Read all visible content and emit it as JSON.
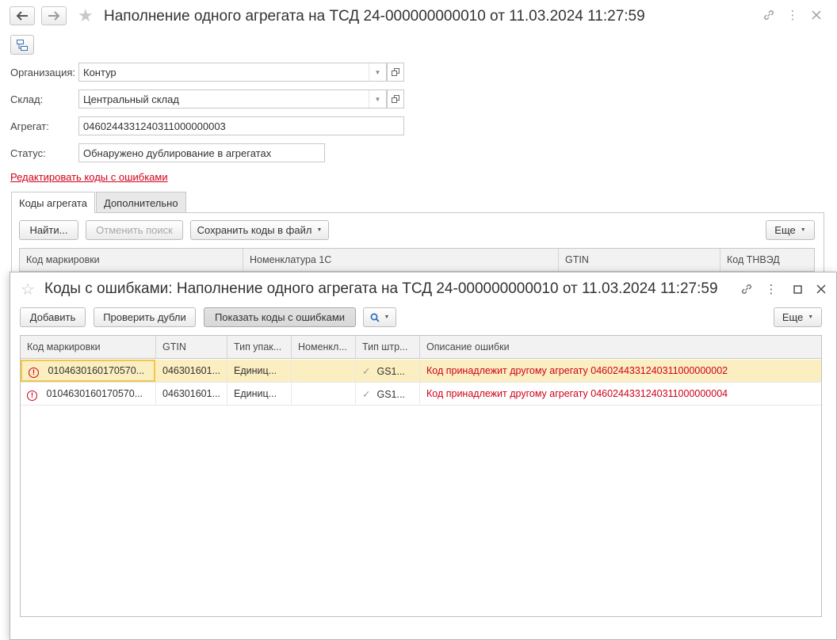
{
  "main": {
    "title": "Наполнение одного агрегата на ТСД 24-000000000010 от 11.03.2024 11:27:59",
    "fields": {
      "org_label": "Организация:",
      "org_value": "Контур",
      "warehouse_label": "Склад:",
      "warehouse_value": "Центральный склад",
      "aggregate_label": "Агрегат:",
      "aggregate_value": "0460244331240311000000003",
      "status_label": "Статус:",
      "status_value": "Обнаружено дублирование в агрегатах"
    },
    "edit_link": "Редактировать коды с ошибками",
    "tabs": [
      {
        "label": "Коды агрегата",
        "active": true
      },
      {
        "label": "Дополнительно",
        "active": false
      }
    ],
    "toolbar": {
      "find": "Найти...",
      "cancel_search": "Отменить поиск",
      "save_codes": "Сохранить коды в файл",
      "more": "Еще"
    },
    "columns": [
      "Код маркировки",
      "Номенклатура 1С",
      "GTIN",
      "Код ТНВЭД"
    ]
  },
  "dialog": {
    "title": "Коды с ошибками: Наполнение одного агрегата на ТСД 24-000000000010 от 11.03.2024 11:27:59",
    "toolbar": {
      "add": "Добавить",
      "check_duplicates": "Проверить дубли",
      "show_errors": "Показать коды с ошибками",
      "more": "Еще"
    },
    "columns": [
      "Код маркировки",
      "GTIN",
      "Тип упак...",
      "Номенкл...",
      "Тип штр...",
      "Описание ошибки"
    ],
    "rows": [
      {
        "code": "0104630160170570...",
        "gtin": "046301601...",
        "pack": "Единиц...",
        "nom": "",
        "bar": "GS1...",
        "error": "Код принадлежит другому агрегату 0460244331240311000000002"
      },
      {
        "code": "0104630160170570...",
        "gtin": "046301601...",
        "pack": "Единиц...",
        "nom": "",
        "bar": "GS1...",
        "error": "Код принадлежит другому агрегату 0460244331240311000000004"
      }
    ]
  },
  "colors": {
    "error": "#d0021b",
    "selected_row": "#fbeec0",
    "focus_border": "#f0c64e"
  }
}
